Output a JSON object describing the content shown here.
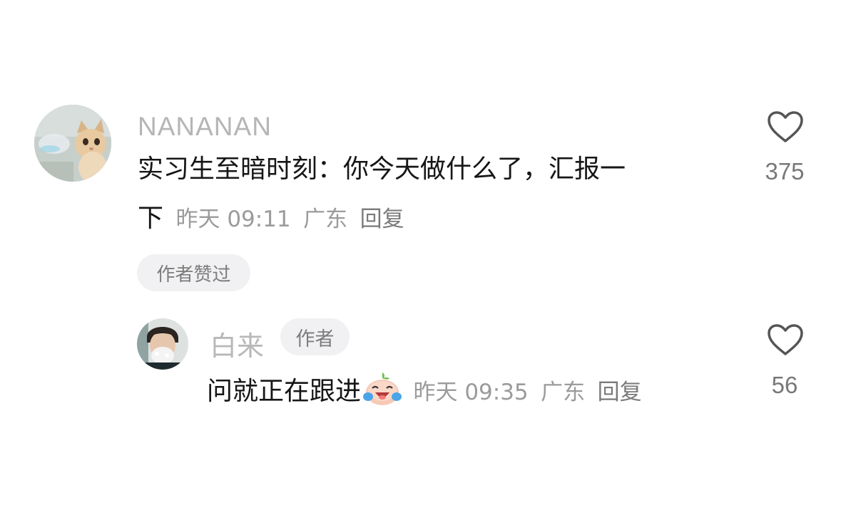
{
  "comment": {
    "username": "NANANAN",
    "text_line1": "实习生至暗时刻：你今天做什么了，汇报一",
    "text_line2": "下",
    "time": "昨天 09:11",
    "location": "广东",
    "reply_label": "回复",
    "author_liked_badge": "作者赞过",
    "like_count": "375",
    "avatar_icon": "cat-avatar"
  },
  "reply": {
    "username": "白来",
    "author_badge": "作者",
    "text": "问就正在跟进",
    "emoji": "crying-laughing-emoji",
    "time": "昨天 09:35",
    "location": "广东",
    "reply_label": "回复",
    "like_count": "56",
    "avatar_icon": "person-avatar"
  },
  "colors": {
    "username": "#b5b5b5",
    "text": "#161616",
    "meta": "#9b9b9b",
    "badge_bg": "#f1f1f3"
  }
}
